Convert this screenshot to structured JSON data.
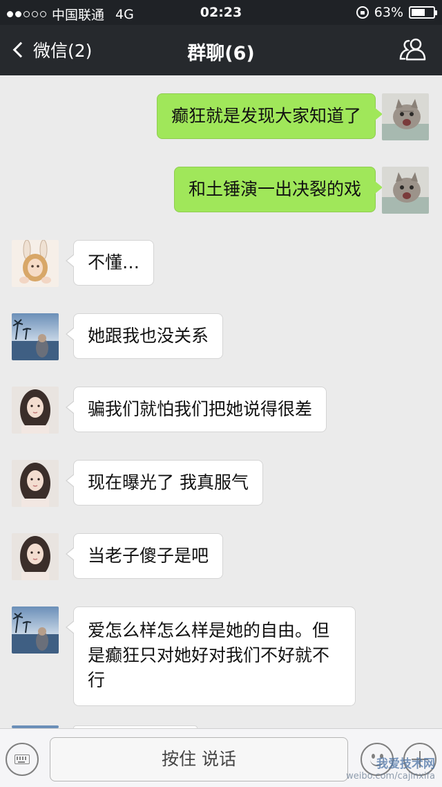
{
  "status_bar": {
    "carrier": "中国联通",
    "network": "4G",
    "time": "02:23",
    "battery": "63%",
    "battery_level": 0.63,
    "signal_bars_filled": 2,
    "signal_bars_total": 5
  },
  "nav": {
    "back_label": "微信(2)",
    "title": "群聊(6)"
  },
  "messages": [
    {
      "sender": "me",
      "avatar": "cat-avatar",
      "text": "癫狂就是发现大家知道了"
    },
    {
      "sender": "me",
      "avatar": "cat-avatar",
      "text": "和土锤演一出决裂的戏"
    },
    {
      "sender": "other",
      "avatar": "bunny-girl-avatar",
      "text": "不懂…"
    },
    {
      "sender": "other",
      "avatar": "beach-sunset-avatar",
      "text": "她跟我也没关系"
    },
    {
      "sender": "other",
      "avatar": "woman-portrait-avatar",
      "text": "骗我们就怕我们把她说得很差"
    },
    {
      "sender": "other",
      "avatar": "woman-portrait-avatar",
      "text": "现在曝光了 我真服气"
    },
    {
      "sender": "other",
      "avatar": "woman-portrait-avatar",
      "text": "当老子傻子是吧"
    },
    {
      "sender": "other",
      "avatar": "beach-sunset-avatar",
      "text": "爱怎么样怎么样是她的自由。但是癫狂只对她好对我们不好就不行"
    }
  ],
  "input_bar": {
    "hold_to_talk_label": "按住 说话"
  },
  "watermark": {
    "line1": "我爱技术网",
    "line2": "weibo.com/cajinxifa"
  },
  "colors": {
    "my_bubble": "#a0e75a",
    "other_bubble": "#ffffff",
    "nav_background": "#26292d",
    "chat_background": "#ebebeb"
  }
}
